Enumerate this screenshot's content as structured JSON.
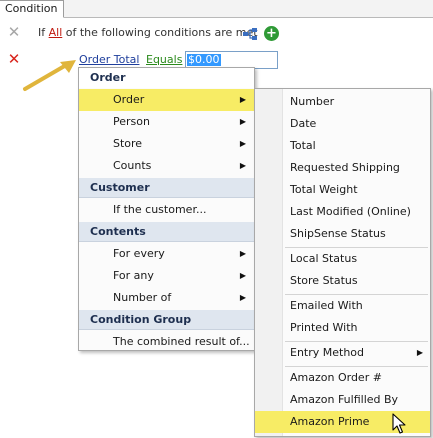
{
  "tab": {
    "label": "Condition"
  },
  "root": {
    "prefix": "If",
    "quantifier": "All",
    "suffix": "of the following conditions are met"
  },
  "condition": {
    "field": "Order Total",
    "operator": "Equals",
    "value": "$0.00"
  },
  "menu1": {
    "groups": [
      {
        "header": "Order",
        "items": [
          {
            "label": "Order",
            "submenu": true
          },
          {
            "label": "Person",
            "submenu": true
          },
          {
            "label": "Store",
            "submenu": true
          },
          {
            "label": "Counts",
            "submenu": true
          }
        ]
      },
      {
        "header": "Customer",
        "items": [
          {
            "label": "If the customer...",
            "submenu": false
          }
        ]
      },
      {
        "header": "Contents",
        "items": [
          {
            "label": "For every",
            "submenu": true
          },
          {
            "label": "For any",
            "submenu": true
          },
          {
            "label": "Number of",
            "submenu": true
          }
        ]
      },
      {
        "header": "Condition Group",
        "items": [
          {
            "label": "The combined result of...",
            "submenu": false
          }
        ]
      }
    ]
  },
  "menu2": {
    "items": [
      {
        "label": "Number"
      },
      {
        "label": "Date"
      },
      {
        "label": "Total"
      },
      {
        "label": "Requested Shipping"
      },
      {
        "label": "Total Weight"
      },
      {
        "label": "Last Modified (Online)"
      },
      {
        "label": "ShipSense Status"
      },
      {
        "label": "Local Status"
      },
      {
        "label": "Store Status"
      },
      {
        "label": "Emailed With"
      },
      {
        "label": "Printed With"
      },
      {
        "label": "Entry Method",
        "submenu": true
      },
      {
        "label": "Amazon Order #"
      },
      {
        "label": "Amazon Fulfilled By"
      },
      {
        "label": "Amazon Prime"
      }
    ]
  },
  "colors": {
    "highlight": "#f7ec65",
    "field_link": "#1f3f9c",
    "operator_link": "#2b8a1c",
    "delete_red": "#d8241c",
    "arrow": "#e0b53c"
  },
  "icons": {
    "disabled_delete": "x-icon",
    "delete": "x-icon",
    "tree": "condition-tree-icon",
    "add": "plus-circle-icon",
    "submenu": "triangle-right-icon",
    "pointer": "mouse-cursor-icon"
  }
}
